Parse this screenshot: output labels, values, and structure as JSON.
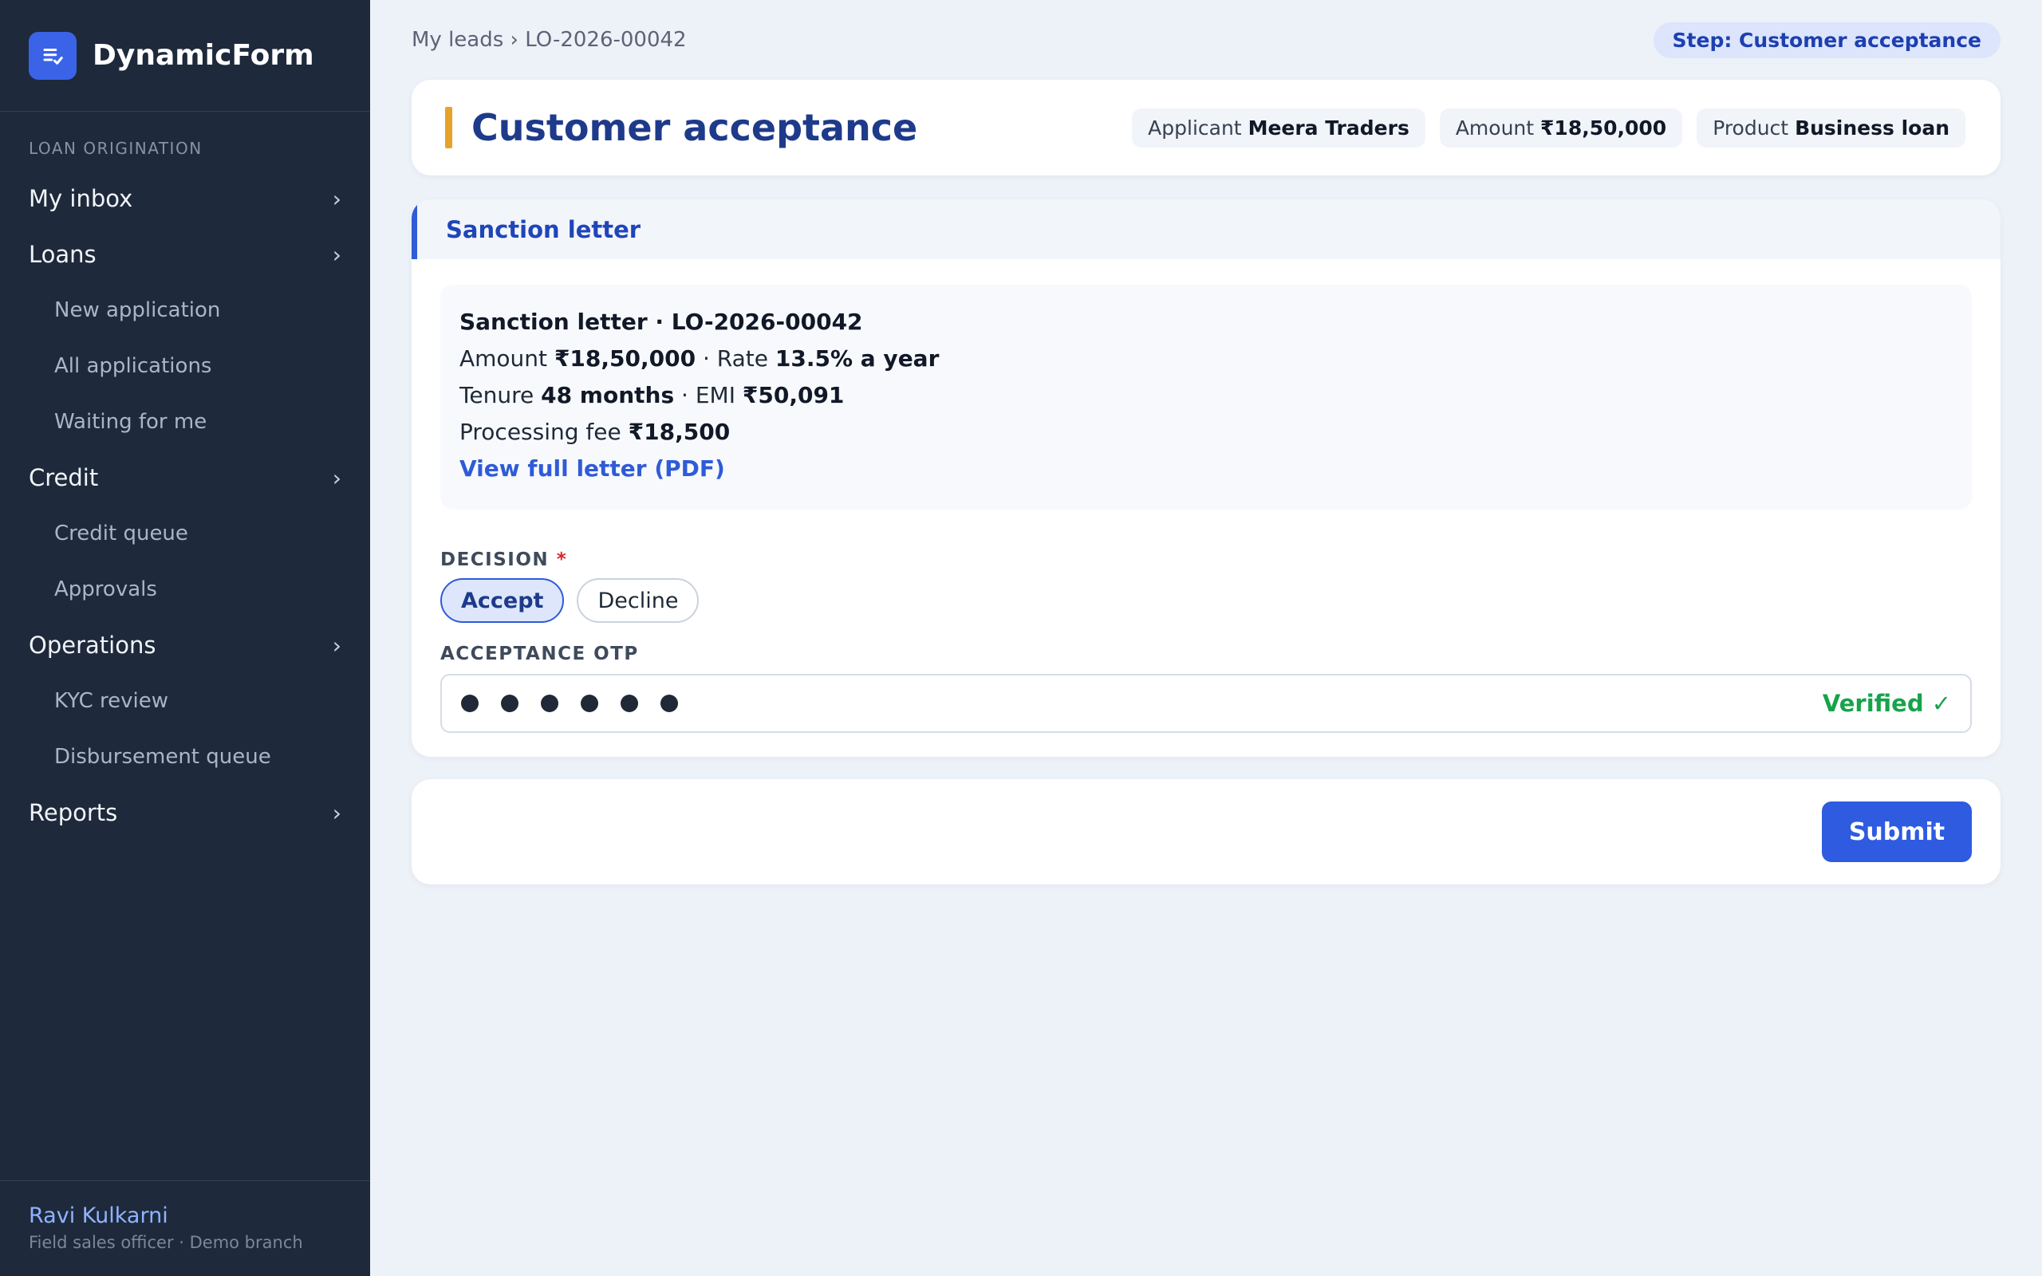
{
  "app": {
    "name": "DynamicForm",
    "logo_icon": "form-check-icon"
  },
  "sidebar": {
    "section_label": "LOAN ORIGINATION",
    "items": [
      {
        "label": "My inbox",
        "type": "group"
      },
      {
        "label": "Loans",
        "type": "group"
      },
      {
        "label": "New application",
        "type": "sub"
      },
      {
        "label": "All applications",
        "type": "sub"
      },
      {
        "label": "Waiting for me",
        "type": "sub"
      },
      {
        "label": "Credit",
        "type": "group"
      },
      {
        "label": "Credit queue",
        "type": "sub"
      },
      {
        "label": "Approvals",
        "type": "sub"
      },
      {
        "label": "Operations",
        "type": "group"
      },
      {
        "label": "KYC review",
        "type": "sub"
      },
      {
        "label": "Disbursement queue",
        "type": "sub"
      },
      {
        "label": "Reports",
        "type": "group"
      }
    ],
    "chevron": "›",
    "user": {
      "name": "Ravi Kulkarni",
      "role": "Field sales officer · Demo branch"
    }
  },
  "topbar": {
    "breadcrumb": "My leads › LO-2026-00042",
    "step": "Step: Customer acceptance"
  },
  "header": {
    "title": "Customer acceptance",
    "chips": {
      "applicant_label": "Applicant",
      "applicant_value": "Meera Traders",
      "amount_label": "Amount",
      "amount_value": "₹18,50,000",
      "product_label": "Product",
      "product_value": "Business loan"
    }
  },
  "section": {
    "title": "Sanction letter",
    "letter": {
      "heading": "Sanction letter · LO-2026-00042",
      "amount_label": "Amount",
      "amount_value": "₹18,50,000",
      "rate_label": "· Rate",
      "rate_value": "13.5% a year",
      "tenure_label": "Tenure",
      "tenure_value": "48 months",
      "emi_label": "· EMI",
      "emi_value": "₹50,091",
      "fee_label": "Processing fee",
      "fee_value": "₹18,500",
      "link": "View full letter (PDF)"
    },
    "decision": {
      "label": "DECISION",
      "required_mark": "*",
      "options": [
        "Accept",
        "Decline"
      ],
      "selected": "Accept"
    },
    "otp": {
      "label": "ACCEPTANCE OTP",
      "masked_digits": 6,
      "status": "Verified ✓"
    }
  },
  "actions": {
    "submit": "Submit"
  },
  "colors": {
    "sidebar_bg": "#1e293b",
    "accent": "#2f5bd8",
    "title_marker": "#e7a22b",
    "verified": "#16a34a",
    "background": "#edf1f8"
  }
}
